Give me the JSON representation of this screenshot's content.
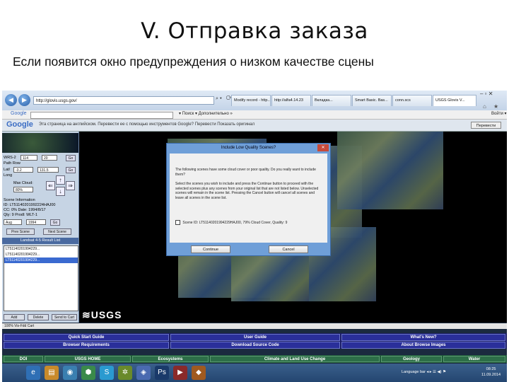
{
  "slide": {
    "title": "V. Отправка заказа",
    "subtitle": "Если появится окно предупреждения о низком качестве сцены"
  },
  "browser": {
    "address": "http://glovis.usgs.gov/",
    "tabs": [
      {
        "label": "Modify record - http..."
      },
      {
        "label": "http://alfa4.14.23"
      },
      {
        "label": "Вкладка..."
      },
      {
        "label": "Smart Basic. Bas..."
      },
      {
        "label": "conn.scs"
      },
      {
        "label": "USGS Glovis V..."
      }
    ],
    "window_controls": "–  ▫  ✕",
    "right_icons": "⌂ ★ ⚙"
  },
  "google_toolbar": {
    "logo": "Google",
    "menu": "▾ Поиск ▾  Дополнительно »",
    "right": "Войти ▾"
  },
  "translate_bar": {
    "logo": "Google",
    "text": "Эта страница на английском. Перевести ее с помощью инструментов Google?  Перевести  Показать оригинал",
    "button": "Перевести"
  },
  "left_panel": {
    "path_label": "WRS-2",
    "path_value": "114",
    "row_value": "20",
    "go": "Go",
    "row_label": "Path Row",
    "lat_label": "Lat/",
    "lat_value": "-3.2",
    "lon_value": "131.5",
    "lon_label": "Long",
    "max_cloud_label": "Max Cloud:",
    "max_cloud_value": "80%",
    "scene_info_label": "Scene Information",
    "scene_lines": [
      "ID: LT51140201992224HAJ00",
      "CC: 0%    Date: 1994/8/17",
      "Qty: 9   Prodl:  WLT-1"
    ],
    "month_value": "Aug",
    "year_value": "1994",
    "prev_scene": "Prev Scene",
    "next_scene": "Next Scene",
    "list_header": "Landsat 4-5 Result List",
    "list_items": [
      "LT51140201994229...",
      "LT51140201994229...",
      "LT51140201994229..."
    ],
    "add": "Add",
    "delete": "Delete",
    "send": "Send to Cart",
    "status": "100%         Vis-Fdd Cart"
  },
  "map": {
    "logo": "≋USGS"
  },
  "dialog": {
    "title": "Include Low Quality Scenes?",
    "paragraph1": "The following scenes have some cloud cover or poor quality. Do you really want to include them?",
    "paragraph2": "Select the scenes you wish to include and press the Continue button to proceed with the selected scenes plus any scenes from your original list that are not listed below. Unselected scenes will remain in the scene list. Pressing the Cancel button will cancel all scenes and leave all scenes in the scene list.",
    "checkbox_label": "Scene ID: LT51140201994229HAJ00, 79% Cloud Cover, Quality: 9",
    "continue": "Continue",
    "cancel": "Cancel"
  },
  "footer": {
    "row1": [
      "Quick Start Guide",
      "User Guide",
      "What's New?"
    ],
    "row2": [
      "Browser Requirements",
      "Download Source Code",
      "About Browse Images"
    ],
    "bar": [
      "DOI",
      "USGS HOME",
      "Ecosystems",
      "Climate and Land Use Change",
      "Geology",
      "Water"
    ]
  },
  "taskbar": {
    "tray": "Language bar ◂ ▸  ☰  ◀)  ⚑",
    "clock_time": "08:25",
    "clock_date": "11.09.2014"
  },
  "colors": {
    "footer_blue": "#1a1c66",
    "footer_green": "#1f5a3a",
    "dialog_frame": "#6f9fd8"
  }
}
